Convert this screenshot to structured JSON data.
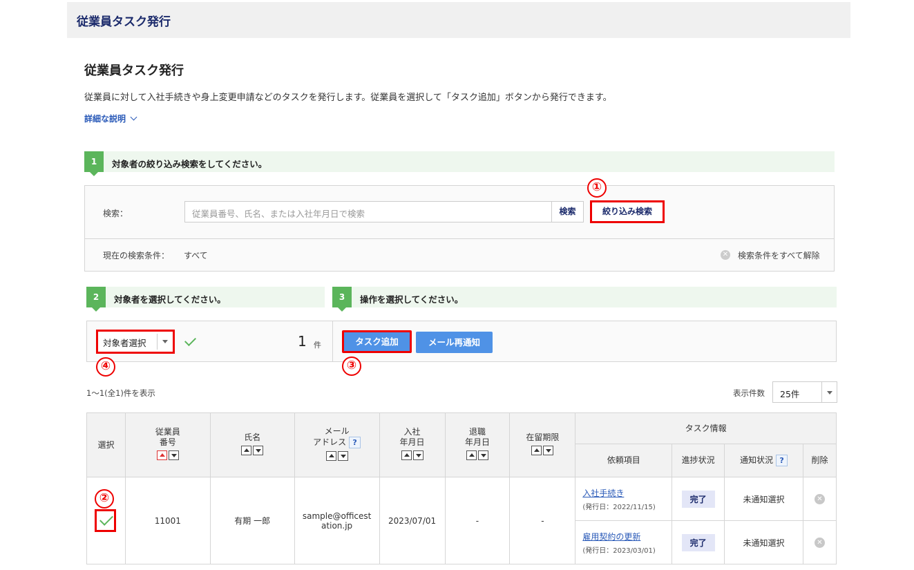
{
  "header": {
    "title": "従業員タスク発行"
  },
  "page": {
    "title": "従業員タスク発行",
    "description": "従業員に対して入社手続きや身上変更申請などのタスクを発行します。従業員を選択して「タスク追加」ボタンから発行できます。",
    "detail_link": "詳細な説明"
  },
  "step1": {
    "num": "1",
    "text": "対象者の絞り込み検索をしてください。"
  },
  "search": {
    "label": "検索：",
    "placeholder": "従業員番号、氏名、または入社年月日で検索",
    "search_btn": "検索",
    "filter_btn": "絞り込み検索",
    "current_label": "現在の検索条件：",
    "current_value": "すべて",
    "clear_label": "検索条件をすべて解除"
  },
  "step2": {
    "num": "2",
    "text": "対象者を選択してください。"
  },
  "step3": {
    "num": "3",
    "text": "操作を選択してください。"
  },
  "selection": {
    "dropdown": "対象者選択",
    "count": "1",
    "unit": "件"
  },
  "actions": {
    "task_add": "タスク追加",
    "mail_resend": "メール再通知"
  },
  "annotations": {
    "n1": "①",
    "n2": "②",
    "n3": "③",
    "n4": "④"
  },
  "list": {
    "showing": "1〜1(全1)件を表示",
    "per_page_label": "表示件数",
    "per_page": "25件"
  },
  "table": {
    "headers": {
      "select": "選択",
      "emp_no_1": "従業員",
      "emp_no_2": "番号",
      "name": "氏名",
      "mail_1": "メール",
      "mail_2": "アドレス",
      "join_1": "入社",
      "join_2": "年月日",
      "leave_1": "退職",
      "leave_2": "年月日",
      "residence": "在留期限",
      "task_info": "タスク情報",
      "request": "依頼項目",
      "progress": "進捗状況",
      "notify": "通知状況",
      "delete": "削除",
      "help": "?"
    },
    "row": {
      "emp_no": "11001",
      "name": "有期 一郎",
      "mail_1": "sample@officest",
      "mail_2": "ation.jp",
      "join": "2023/07/01",
      "leave": "-",
      "residence": "-",
      "tasks": [
        {
          "name": "入社手続き",
          "date": "(発行日：2022/11/15)",
          "status": "完了",
          "notify": "未通知選択"
        },
        {
          "name": "雇用契約の更新",
          "date": "(発行日：2023/03/01)",
          "status": "完了",
          "notify": "未通知選択"
        }
      ]
    }
  }
}
